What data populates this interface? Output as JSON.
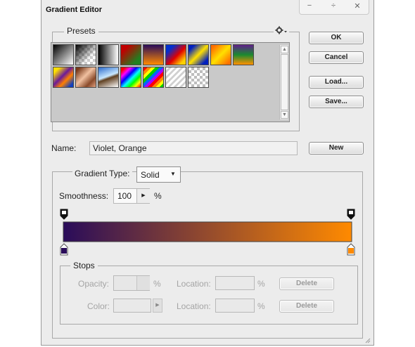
{
  "window": {
    "title": "Gradient Editor",
    "controls": {
      "minimize": "−",
      "restore": "÷",
      "close": "✕"
    }
  },
  "presets": {
    "legend": "Presets",
    "gear_icon": "gear-icon",
    "swatches": [
      {
        "name": "foreground-to-background",
        "css": "linear-gradient(135deg,#000 0%,#fff 100%)"
      },
      {
        "name": "foreground-to-transparent",
        "css": "linear-gradient(135deg,#000 0%,rgba(0,0,0,0) 70%),repeating-conic-gradient(#ccc 0% 25%,#fff 0% 50%) 0 0/8px 8px"
      },
      {
        "name": "black-white",
        "css": "linear-gradient(90deg,#000 0%,#fff 100%)"
      },
      {
        "name": "red-green",
        "css": "linear-gradient(135deg,#c00000 20%,#208020 80%)"
      },
      {
        "name": "violet-orange",
        "css": "linear-gradient(180deg,#2a0c5a 0%,#ff8a00 100%)"
      },
      {
        "name": "blue-red-yellow",
        "css": "linear-gradient(135deg,#0030d0 20%,#e00000 55%,#ffd000 85%)"
      },
      {
        "name": "blue-yellow-blue",
        "css": "linear-gradient(135deg,#0020c0 15%,#ffe000 50%,#0020c0 85%)"
      },
      {
        "name": "orange-yellow-orange",
        "css": "linear-gradient(135deg,#ff7000 10%,#ffe000 50%,#ff7000 90%)"
      },
      {
        "name": "violet-green-orange",
        "css": "linear-gradient(180deg,#60208a 0%,#1a8a30 50%,#ff9000 100%)"
      },
      {
        "name": "yellow-violet-orange-blue",
        "css": "linear-gradient(135deg,#ffe000 15%,#6a1a9a 45%,#ff8000 65%,#1040c0 90%)"
      },
      {
        "name": "copper",
        "css": "linear-gradient(135deg,#7a3a1a 10%,#f0c0a0 45%,#8a4a2a 75%,#e0a080 100%)"
      },
      {
        "name": "chrome",
        "css": "linear-gradient(160deg,#2a6acc 0%,#c8e8ff 45%,#604020 55%,#fff 100%)"
      },
      {
        "name": "spectrum",
        "css": "linear-gradient(135deg,#ff0000 10%,#ff00ff 25%,#0000ff 40%,#00ffff 55%,#00ff00 70%,#ffff00 85%,#ff0000 100%)"
      },
      {
        "name": "transparent-rainbow",
        "css": "repeating-linear-gradient(135deg,#ff0000 0 4px,#ff8800 4px 8px,#ffff00 8px 12px,#00cc00 12px 16px,#0066ff 16px 20px,#aa00ff 20px 24px)"
      },
      {
        "name": "transparent-stripes",
        "css": "repeating-linear-gradient(135deg,#ffffff 0 3px,#d0d0d0 3px 6px)"
      },
      {
        "name": "neutral-density",
        "css": "repeating-conic-gradient(#bdbdbd 0% 25%,#ffffff 0% 50%) 0 0/8px 8px"
      }
    ]
  },
  "buttons": {
    "ok": "OK",
    "cancel": "Cancel",
    "load": "Load...",
    "save": "Save...",
    "new": "New"
  },
  "name_field": {
    "label": "Name:",
    "value": "Violet, Orange"
  },
  "gradient_type": {
    "label": "Gradient Type:",
    "selected": "Solid"
  },
  "smoothness": {
    "label": "Smoothness:",
    "value": "100",
    "unit": "%"
  },
  "gradient_bar": {
    "colors": [
      "#2a0c5a",
      "#ff8a00"
    ],
    "opacity_stops": [
      {
        "location": 0
      },
      {
        "location": 100
      }
    ],
    "color_stops": [
      {
        "location": 0,
        "color": "#2a0c5a"
      },
      {
        "location": 100,
        "color": "#ff8a00"
      }
    ]
  },
  "stops": {
    "legend": "Stops",
    "opacity_label": "Opacity:",
    "opacity_unit": "%",
    "color_label": "Color:",
    "location_label": "Location:",
    "location_unit": "%",
    "delete": "Delete"
  }
}
